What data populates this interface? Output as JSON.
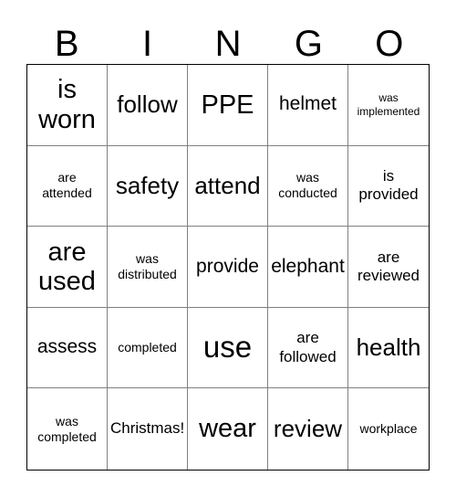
{
  "card": {
    "title": "BINGO",
    "header_letters": [
      "B",
      "I",
      "N",
      "G",
      "O"
    ],
    "colors": {
      "background": "#ffffff",
      "text": "#000000",
      "inner_border": "#808080",
      "outer_border": "#000000"
    },
    "grid": {
      "rows": 5,
      "columns": 5,
      "cells": [
        [
          {
            "text": "is\nworn",
            "size": "xxl"
          },
          {
            "text": "follow",
            "size": "xl"
          },
          {
            "text": "PPE",
            "size": "xxl"
          },
          {
            "text": "helmet",
            "size": "lg"
          },
          {
            "text": "was\nimplemented",
            "size": "xs"
          }
        ],
        [
          {
            "text": "are\nattended",
            "size": "sm"
          },
          {
            "text": "safety",
            "size": "xl"
          },
          {
            "text": "attend",
            "size": "xl"
          },
          {
            "text": "was\nconducted",
            "size": "sm"
          },
          {
            "text": "is\nprovided",
            "size": "md"
          }
        ],
        [
          {
            "text": "are\nused",
            "size": "xxl"
          },
          {
            "text": "was\ndistributed",
            "size": "sm"
          },
          {
            "text": "provide",
            "size": "lg"
          },
          {
            "text": "elephant",
            "size": "lg"
          },
          {
            "text": "are\nreviewed",
            "size": "md"
          }
        ],
        [
          {
            "text": "assess",
            "size": "lg"
          },
          {
            "text": "completed",
            "size": "sm"
          },
          {
            "text": "use",
            "size": "max"
          },
          {
            "text": "are\nfollowed",
            "size": "md"
          },
          {
            "text": "health",
            "size": "xl"
          }
        ],
        [
          {
            "text": "was\ncompleted",
            "size": "sm"
          },
          {
            "text": "Christmas!",
            "size": "md"
          },
          {
            "text": "wear",
            "size": "xxl"
          },
          {
            "text": "review",
            "size": "xl"
          },
          {
            "text": "workplace",
            "size": "sm"
          }
        ]
      ]
    }
  }
}
